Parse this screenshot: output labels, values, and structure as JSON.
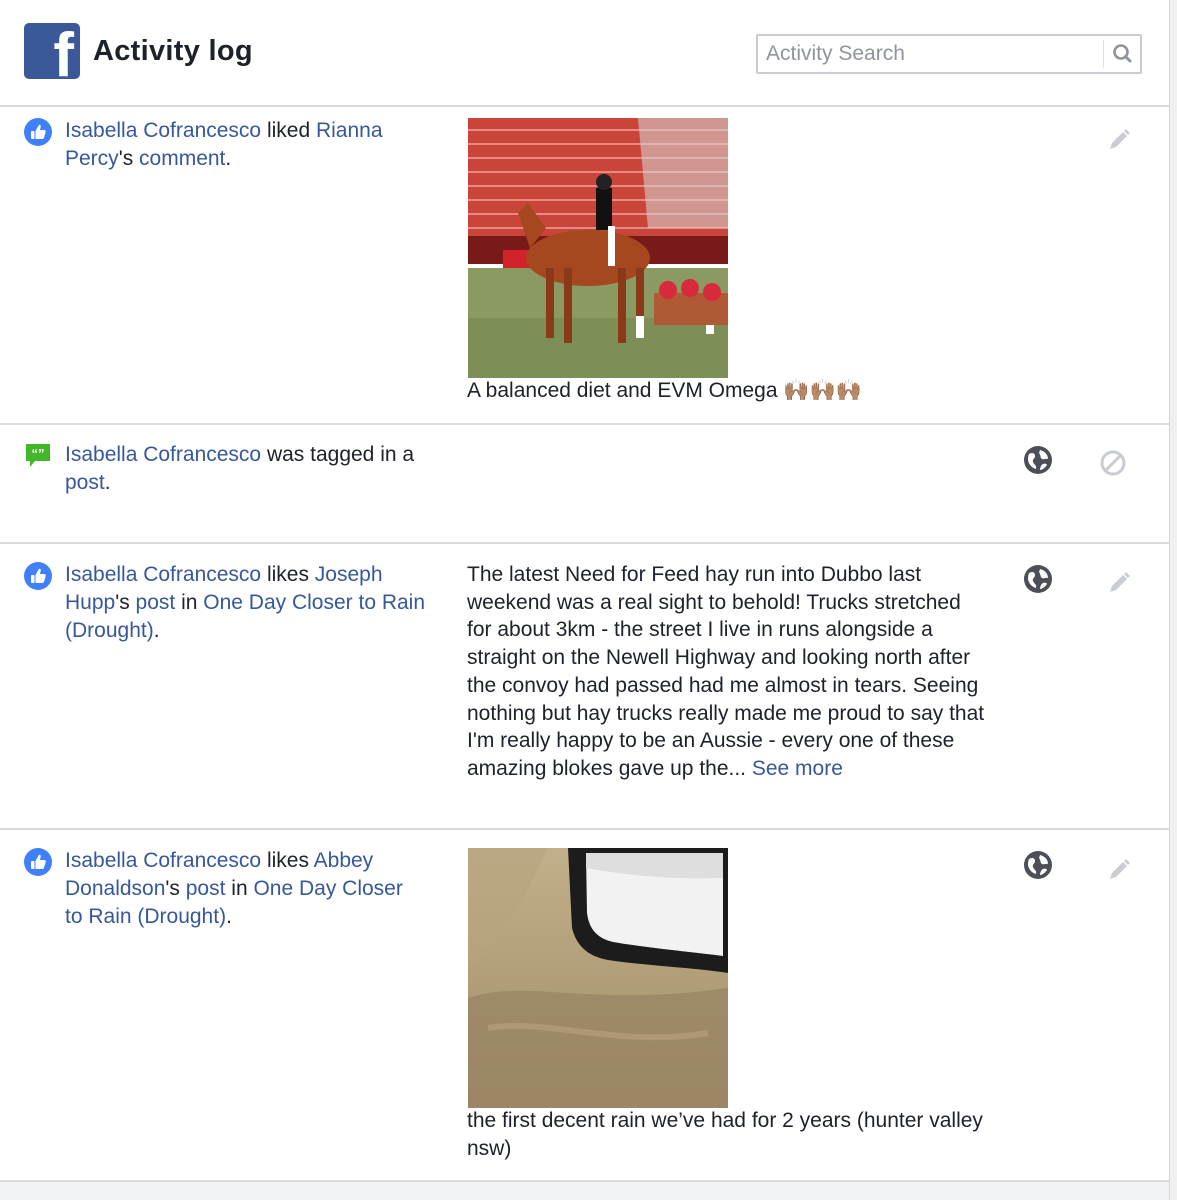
{
  "header": {
    "title": "Activity log",
    "search_placeholder": "Activity Search"
  },
  "colors": {
    "brand": "#3b5998",
    "link": "#365899",
    "like_icon": "#4080ff",
    "comment_icon": "#42b72a"
  },
  "icons": {
    "logo": "facebook-logo-icon",
    "search": "search-icon",
    "like": "thumbs-up-icon",
    "comment": "comment-bubble-icon",
    "audience": "globe-icon",
    "edit": "pencil-icon",
    "hide": "block-icon"
  },
  "entries": [
    {
      "actor": "Isabella Cofrancesco",
      "verb": " liked ",
      "target": "Rianna Percy",
      "possessive": "'s ",
      "object": "comment",
      "end": ".",
      "caption": "A balanced diet and EVM Omega",
      "caption_emoji": "🙌🏽🙌🏽🙌🏽"
    },
    {
      "actor": "Isabella Cofrancesco",
      "verb": " was tagged in a ",
      "object": "post",
      "end": "."
    },
    {
      "actor": "Isabella Cofrancesco",
      "verb": " likes ",
      "target": "Joseph Hupp",
      "possessive": "'s ",
      "object": "post",
      "in": " in ",
      "group": "One Day Closer to Rain (Drought)",
      "end": ".",
      "body": "The latest Need for Feed hay run into Dubbo last weekend was a real sight to behold! Trucks stretched for about 3km - the street I live in runs alongside a straight on the Newell Highway and looking north after the convoy had passed had me almost in tears. Seeing nothing but hay trucks really made me proud to say that I'm really happy to be an Aussie - every one of these amazing blokes gave up the...",
      "see_more": "See more"
    },
    {
      "actor": "Isabella Cofrancesco",
      "verb": " likes ",
      "target": "Abbey Donaldson",
      "possessive": "'s ",
      "object": "post",
      "in": " in ",
      "group": "One Day Closer to Rain (Drought)",
      "end": ".",
      "caption": "the first decent rain we’ve had for 2 years (hunter valley nsw)"
    }
  ]
}
